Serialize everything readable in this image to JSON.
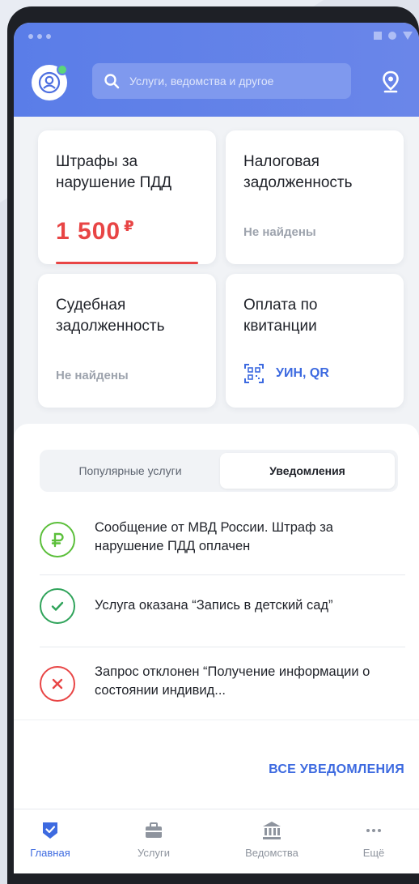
{
  "search": {
    "placeholder": "Услуги, ведомства и другое",
    "icon": "search-icon"
  },
  "cards": {
    "fines": {
      "title": "Штрафы за нарушение ПДД",
      "amount": "1 500",
      "currency": "₽"
    },
    "tax": {
      "title": "Налоговая задолженность",
      "status": "Не найдены"
    },
    "court": {
      "title": "Судебная задолженность",
      "status": "Не найдены"
    },
    "receipt": {
      "title": "Оплата по квитанции",
      "action": "УИН, QR"
    }
  },
  "tabs": {
    "popular": "Популярные услуги",
    "notifications": "Уведомления"
  },
  "notifications": [
    {
      "type": "payment",
      "text": "Сообщение от МВД России. Штраф за нарушение ПДД оплачен",
      "color": "#5bbf3a"
    },
    {
      "type": "success",
      "text": "Услуга оказана “Запись в детский сад”",
      "color": "#2fa35a"
    },
    {
      "type": "rejected",
      "text": "Запрос отклонен “Получение информации о состоянии индивид...",
      "color": "#e84545"
    }
  ],
  "all_notifications": "ВСЕ УВЕДОМЛЕНИЯ",
  "bottom_nav": [
    {
      "label": "Главная",
      "icon": "shield-check-icon",
      "active": true
    },
    {
      "label": "Услуги",
      "icon": "briefcase-icon",
      "active": false
    },
    {
      "label": "Ведомства",
      "icon": "bank-icon",
      "active": false
    },
    {
      "label": "Ещё",
      "icon": "more-dots-icon",
      "active": false
    }
  ],
  "colors": {
    "accent": "#3d6ae0",
    "header": "#5a7de8",
    "danger": "#e84545"
  }
}
